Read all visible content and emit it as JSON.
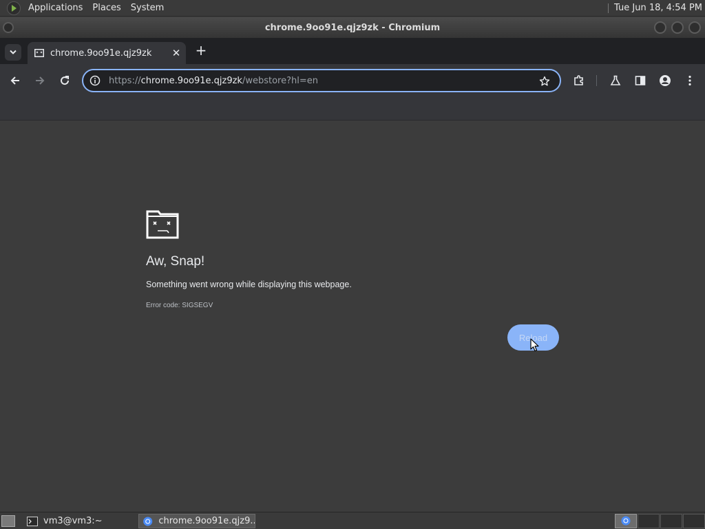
{
  "top_panel": {
    "menus": [
      "Applications",
      "Places",
      "System"
    ],
    "clock": "Tue Jun 18,  4:54 PM"
  },
  "window": {
    "title": "chrome.9oo91e.qjz9zk - Chromium"
  },
  "tabs": [
    {
      "title": "chrome.9oo91e.qjz9zk",
      "close_icon": "close-icon"
    }
  ],
  "new_tab_label": "+",
  "omnibox": {
    "scheme": "https://",
    "host": "chrome.9oo91e.qjz9zk",
    "path": "/webstore?hl=en"
  },
  "toolbar_icons": [
    "back-icon",
    "forward-icon",
    "reload-icon",
    "extensions-icon",
    "labs-icon",
    "side-panel-icon",
    "profile-icon",
    "menu-icon"
  ],
  "error_page": {
    "title": "Aw, Snap!",
    "message": "Something went wrong while displaying this webpage.",
    "error_code": "Error code: SIGSEGV",
    "reload_label": "Reload"
  },
  "taskbar": {
    "items": [
      {
        "label": "vm3@vm3:~",
        "icon": "terminal-icon"
      },
      {
        "label": "chrome.9oo91e.qjz9...",
        "icon": "chromium-icon",
        "active": true
      }
    ]
  },
  "colors": {
    "accent": "#8ab4f8",
    "page_bg": "#3c3c3c",
    "toolbar_bg": "#35363a",
    "tabstrip_bg": "#202124"
  }
}
